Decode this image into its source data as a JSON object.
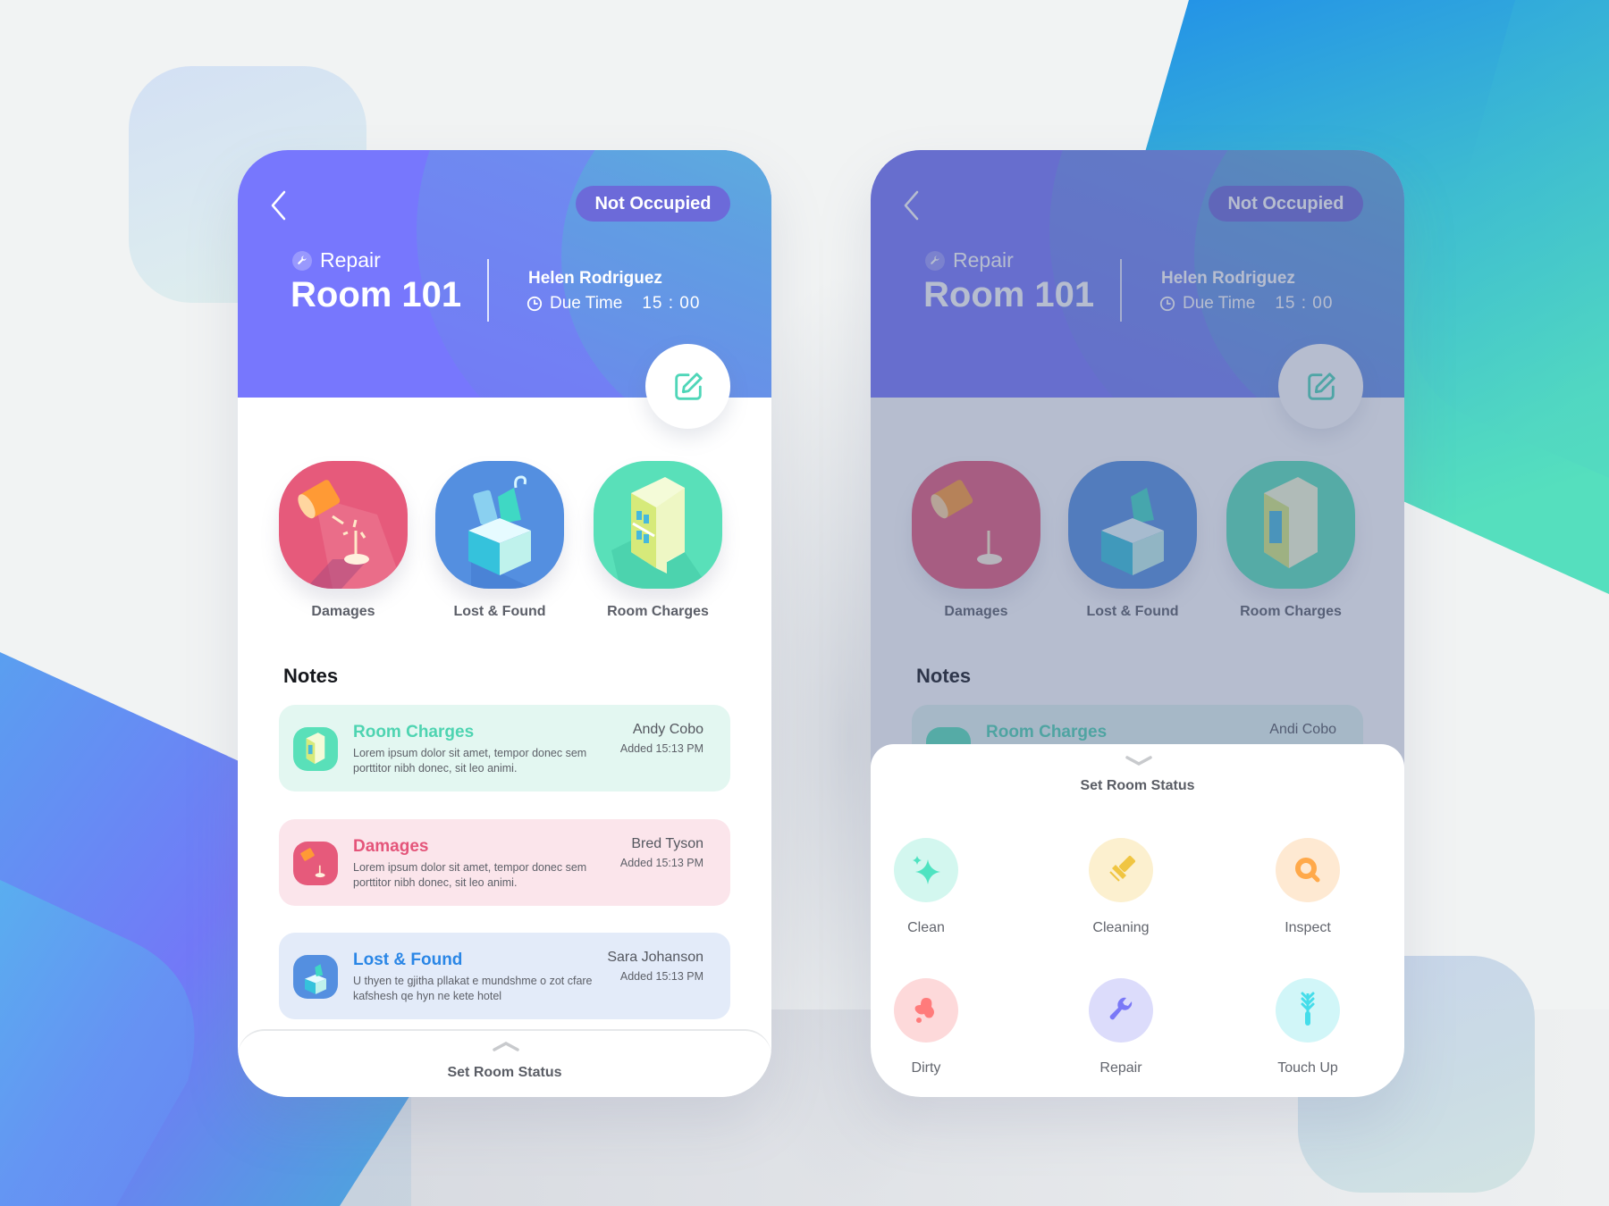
{
  "screens": [
    {
      "id": "room-detail",
      "header": {
        "back_label": "Back",
        "status_badge": "Not Occupied",
        "task_type": "Repair",
        "room_name": "Room 101",
        "assignee": "Helen Rodriguez",
        "due_label": "Due Time",
        "due_value": "15 : 00"
      },
      "categories": [
        {
          "label": "Damages",
          "icon": "lamp-icon",
          "color": "#e65a7b"
        },
        {
          "label": "Lost & Found",
          "icon": "box-icon",
          "color": "#548fe0"
        },
        {
          "label": "Room Charges",
          "icon": "fridge-icon",
          "color": "#59e0b9"
        }
      ],
      "notes_title": "Notes",
      "notes": [
        {
          "title": "Room Charges",
          "body": "Lorem ipsum dolor sit amet, tempor donec sem porttitor nibh donec, sit leo animi.",
          "author": "Andy Cobo",
          "time": "Added 15:13 PM"
        },
        {
          "title": "Damages",
          "body": "Lorem ipsum dolor sit amet, tempor donec sem porttitor nibh donec, sit leo animi.",
          "author": "Bred Tyson",
          "time": "Added 15:13 PM"
        },
        {
          "title": "Lost & Found",
          "body": "U thyen te gjitha pllakat e mundshme o zot cfare kafshesh qe hyn ne kete hotel",
          "author": "Sara Johanson",
          "time": "Added 15:13 PM"
        }
      ],
      "bottom_bar_label": "Set Room Status"
    },
    {
      "id": "set-status",
      "header": {
        "status_badge": "Not Occupied",
        "task_type": "Repair",
        "room_name": "Room 101",
        "assignee": "Helen Rodriguez",
        "due_label": "Due Time",
        "due_value": "15 : 00"
      },
      "categories": [
        {
          "label": "Damages"
        },
        {
          "label": "Lost & Found"
        },
        {
          "label": "Room Charges"
        }
      ],
      "notes_title": "Notes",
      "peek_note": {
        "title": "Room Charges",
        "author": "Andi Cobo"
      },
      "sheet_title": "Set Room Status",
      "status_options": [
        {
          "label": "Clean",
          "icon": "sparkle-icon",
          "color": "#4fe3c1",
          "bg": "#d3f7ef"
        },
        {
          "label": "Cleaning",
          "icon": "squeegee-icon",
          "color": "#f0c542",
          "bg": "#fcf0cf"
        },
        {
          "label": "Inspect",
          "icon": "magnifier-icon",
          "color": "#ffa94a",
          "bg": "#fee9d2"
        },
        {
          "label": "Dirty",
          "icon": "stain-icon",
          "color": "#ff7b7b",
          "bg": "#fdd9da"
        },
        {
          "label": "Repair",
          "icon": "wrench-icon",
          "color": "#7a78f7",
          "bg": "#dcdcfb"
        },
        {
          "label": "Touch Up",
          "icon": "duster-icon",
          "color": "#45ddea",
          "bg": "#d1f6f8"
        }
      ]
    }
  ]
}
